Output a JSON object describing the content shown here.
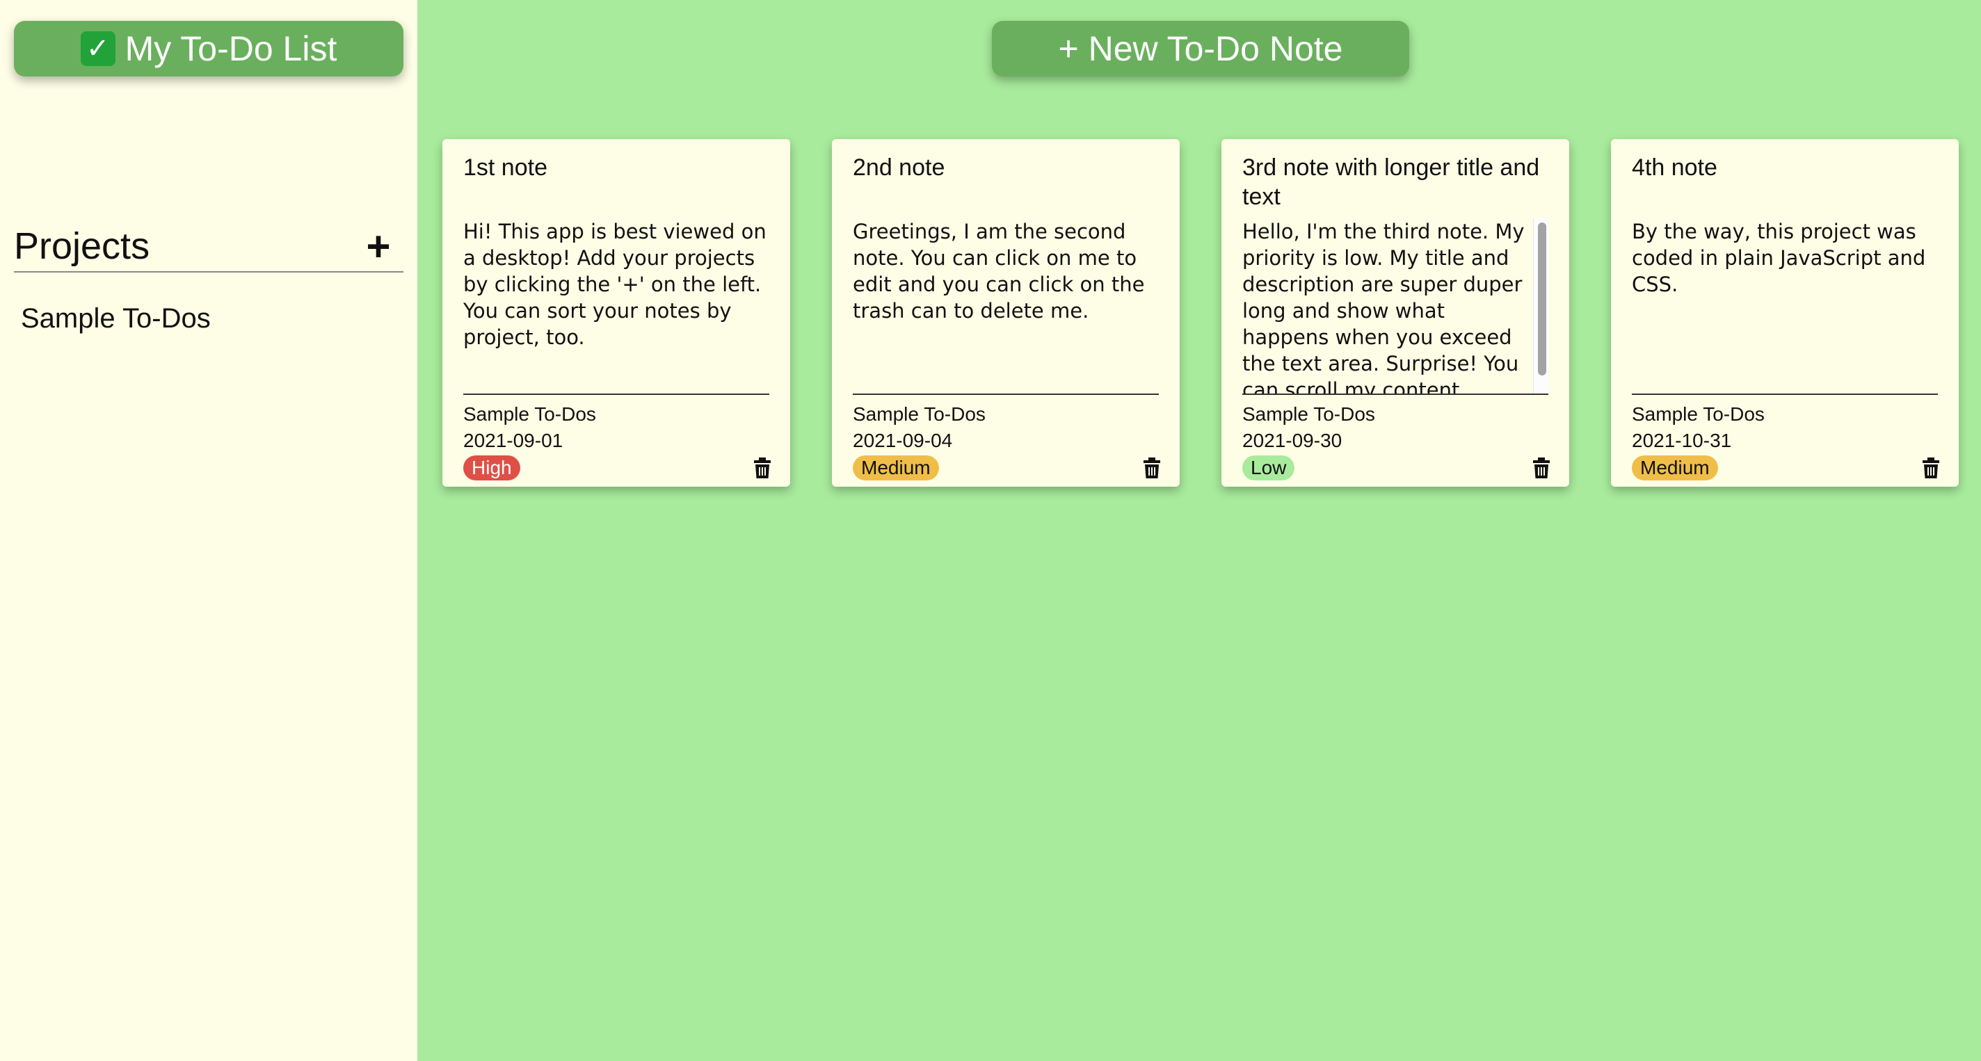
{
  "sidebar": {
    "logo": {
      "icon": "check-icon",
      "check_glyph": "✓",
      "label": "My To-Do List"
    },
    "projects_title": "Projects",
    "add_project_label": "+",
    "projects": [
      "Sample To-Dos"
    ]
  },
  "toolbar": {
    "new_note_label": "+ New To-Do Note"
  },
  "notes": [
    {
      "title": "1st note",
      "description": "Hi! This app is best viewed on a desktop! Add your projects by clicking the '+' on the left. You can sort your notes by project, too.",
      "project": "Sample To-Dos",
      "date": "2021-09-01",
      "priority": "High",
      "priority_color": "#e04f45",
      "priority_text_color": "#ffffff"
    },
    {
      "title": "2nd note",
      "description": "Greetings, I am the second note. You can click on me to edit and you can click on the trash can to delete me.",
      "project": "Sample To-Dos",
      "date": "2021-09-04",
      "priority": "Medium",
      "priority_color": "#f0be48",
      "priority_text_color": "#111111"
    },
    {
      "title": "3rd note with longer title and text",
      "description": "Hello, I'm the third note. My priority is low. My title and description are super duper long and show what happens when you exceed the text area. Surprise! You can scroll my content.",
      "project": "Sample To-Dos",
      "date": "2021-09-30",
      "priority": "Low",
      "priority_color": "#a8eb9c",
      "priority_text_color": "#111111"
    },
    {
      "title": "4th note",
      "description": "By the way, this project was coded in plain JavaScript and CSS.",
      "project": "Sample To-Dos",
      "date": "2021-10-31",
      "priority": "Medium",
      "priority_color": "#f0be48",
      "priority_text_color": "#111111"
    }
  ],
  "colors": {
    "page_background": "#a8eb9c",
    "sidebar_background": "#fefee6",
    "button_background": "#6aaf5d",
    "card_background": "#fefee6"
  }
}
